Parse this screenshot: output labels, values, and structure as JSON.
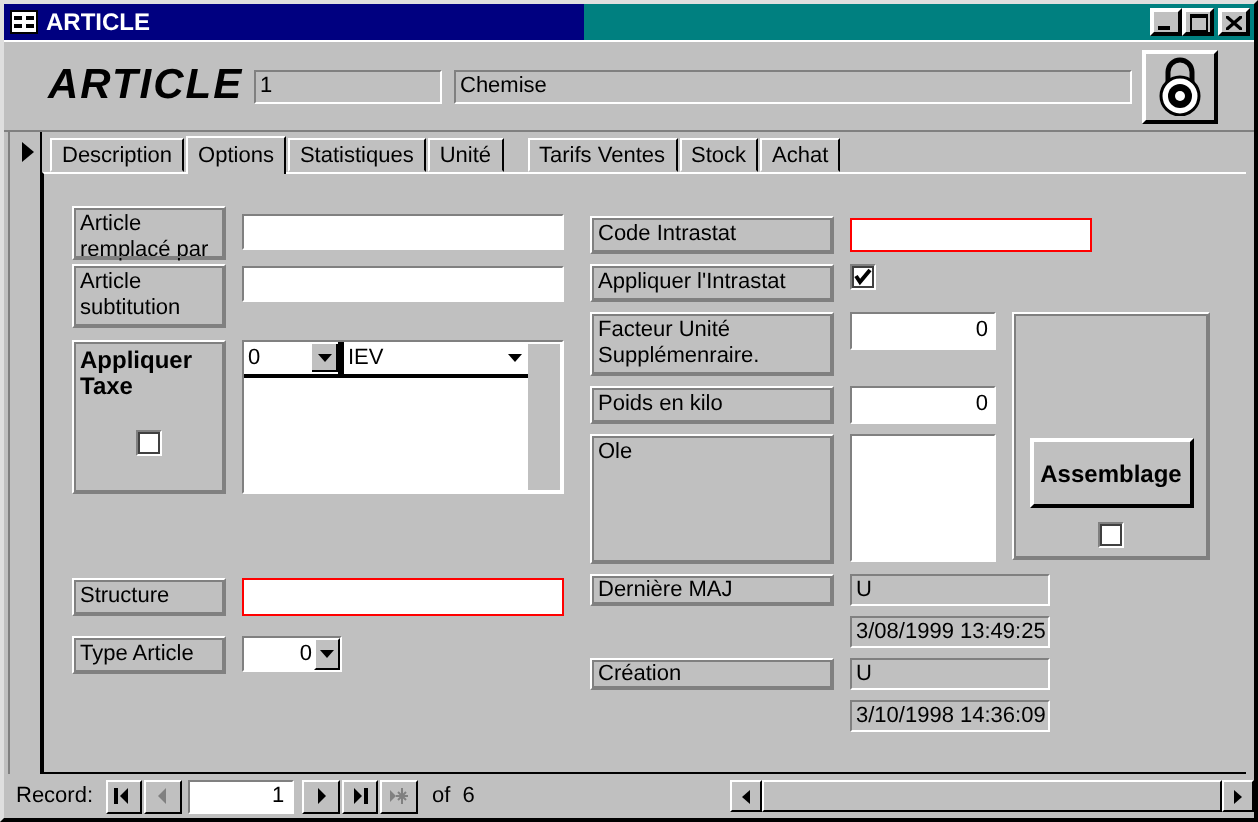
{
  "window": {
    "title": "ARTICLE"
  },
  "header": {
    "title": "ARTICLE",
    "code": "1",
    "name": "Chemise"
  },
  "tabs": [
    {
      "label": "Description",
      "selected": false
    },
    {
      "label": "Options",
      "selected": true
    },
    {
      "label": "Statistiques",
      "selected": false
    },
    {
      "label": "Unité",
      "selected": false
    },
    {
      "label": "Tarifs Ventes",
      "selected": false
    },
    {
      "label": "Stock",
      "selected": false
    },
    {
      "label": "Achat",
      "selected": false
    }
  ],
  "left_fields": [
    {
      "kind": "text",
      "label": "Article remplacé par",
      "required": false
    },
    {
      "kind": "text",
      "label": "Article subtitution",
      "required": false
    },
    {
      "kind": "tax",
      "label": "Appliquer Taxe",
      "checked": false,
      "subform": {
        "code": "0",
        "name": "IEV"
      }
    },
    {
      "kind": "text",
      "label": "Structure",
      "required": true
    },
    {
      "kind": "combo",
      "label": "Type Article",
      "value": "0"
    }
  ],
  "right_fields": [
    {
      "kind": "text",
      "label": "Code Intrastat",
      "required": true
    },
    {
      "kind": "check",
      "label": "Appliquer l'Intrastat",
      "checked": true
    },
    {
      "kind": "number",
      "label": "Facteur Unité Supplémenraire.",
      "value": "0"
    },
    {
      "kind": "number",
      "label": "Poids en kilo",
      "value": "0"
    },
    {
      "kind": "ole",
      "label": "Ole"
    },
    {
      "kind": "audit",
      "label": "Dernière MAJ",
      "user": "U",
      "date": "3/08/1999 13:49:25"
    },
    {
      "kind": "audit",
      "label": "Création",
      "user": "U",
      "date": "3/10/1998 14:36:09"
    }
  ],
  "assembly": {
    "label": "Assemblage",
    "checked": false
  },
  "navigator": {
    "label": "Record:",
    "current": "1",
    "count": "of  6",
    "prev_disabled": true,
    "new_disabled": true
  }
}
